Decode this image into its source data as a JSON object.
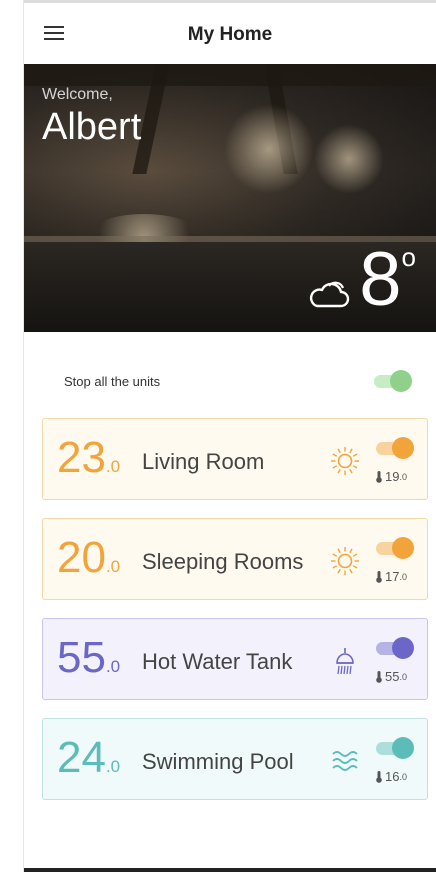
{
  "header": {
    "title": "My Home",
    "menu_icon": "hamburger-menu-icon"
  },
  "hero": {
    "welcome": "Welcome,",
    "username": "Albert",
    "weather_icon": "cloud-sun-icon",
    "temperature": "8",
    "degree": "o"
  },
  "master": {
    "label": "Stop all the units",
    "on": true,
    "color": "#8fd18a"
  },
  "units": [
    {
      "value": "23",
      "decimal": ".0",
      "name": "Living Room",
      "icon": "sun-icon",
      "on": true,
      "set_value": "19",
      "set_decimal": ".0",
      "color": "#f2a43a",
      "bg": "#fffaf0",
      "border": "#f4d9a8"
    },
    {
      "value": "20",
      "decimal": ".0",
      "name": "Sleeping Rooms",
      "icon": "sun-icon",
      "on": true,
      "set_value": "17",
      "set_decimal": ".0",
      "color": "#f2a43a",
      "bg": "#fffaf0",
      "border": "#f4d9a8"
    },
    {
      "value": "55",
      "decimal": ".0",
      "name": "Hot Water Tank",
      "icon": "shower-icon",
      "on": true,
      "set_value": "55",
      "set_decimal": ".0",
      "color": "#6b67c9",
      "bg": "#f3f2fc",
      "border": "#c9c6ee"
    },
    {
      "value": "24",
      "decimal": ".0",
      "name": "Swimming Pool",
      "icon": "waves-icon",
      "on": true,
      "set_value": "16",
      "set_decimal": ".0",
      "color": "#5cbcb8",
      "bg": "#f1fafa",
      "border": "#bfe3e1"
    }
  ]
}
